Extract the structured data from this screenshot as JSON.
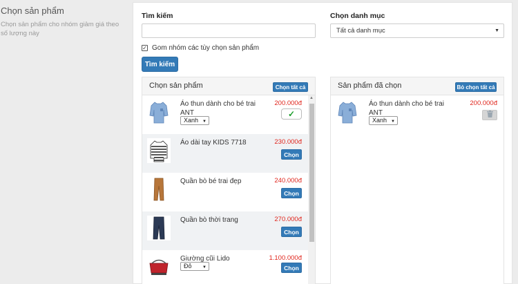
{
  "sidebar": {
    "title": "Chọn sản phẩm",
    "description": "Chọn sản phẩm cho nhóm giảm giá theo số lượng này"
  },
  "search": {
    "label": "Tìm kiếm",
    "value": "",
    "placeholder": ""
  },
  "category": {
    "label": "Chọn danh mục",
    "selected": "Tất cả danh mục"
  },
  "options": {
    "group_label": "Gom nhóm các tùy chọn sản phẩm",
    "group_checked": true
  },
  "buttons": {
    "search": "Tìm kiếm",
    "select_all": "Chọn tất cả",
    "deselect_all": "Bỏ chọn tất cả",
    "choose": "Chọn"
  },
  "available": {
    "title": "Chọn sản phẩm",
    "items": [
      {
        "name": "Áo thun dành cho bé trai ANT",
        "price": "200.000đ",
        "variant": "Xanh",
        "selected": true,
        "image_icon": "blue-shirt-icon"
      },
      {
        "name": "Áo dài tay KIDS 7718",
        "price": "230.000đ",
        "variant": "",
        "selected": false,
        "image_icon": "striped-shirt-icon"
      },
      {
        "name": "Quần bò bé trai đẹp",
        "price": "240.000đ",
        "variant": "",
        "selected": false,
        "image_icon": "brown-pants-icon"
      },
      {
        "name": "Quần bò thời trang",
        "price": "270.000đ",
        "variant": "",
        "selected": false,
        "image_icon": "jeans-icon"
      },
      {
        "name": "Giường cũi Lido",
        "price": "1.100.000đ",
        "variant": "Đỏ",
        "selected": false,
        "image_icon": "crib-icon"
      }
    ]
  },
  "chosen": {
    "title": "Sản phẩm đã chọn",
    "items": [
      {
        "name": "Áo thun dành cho bé trai ANT",
        "price": "200.000đ",
        "variant": "Xanh",
        "image_icon": "blue-shirt-icon"
      }
    ]
  },
  "colors": {
    "primary": "#337ab7",
    "price": "#e0261d",
    "check": "#1a9e2a"
  }
}
